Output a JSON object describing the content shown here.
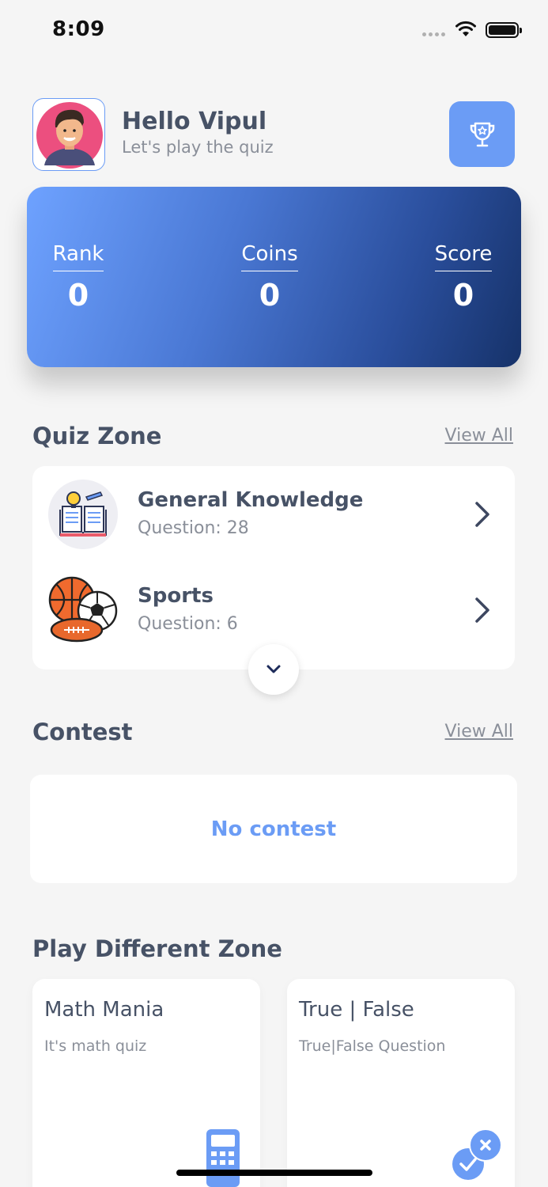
{
  "status_bar": {
    "time": "8:09"
  },
  "header": {
    "greeting": "Hello Vipul",
    "subtitle": "Let's play the quiz"
  },
  "stats": {
    "rank_label": "Rank",
    "rank_value": "0",
    "coins_label": "Coins",
    "coins_value": "0",
    "score_label": "Score",
    "score_value": "0"
  },
  "quiz_zone": {
    "title": "Quiz Zone",
    "view_all": "View All",
    "items": [
      {
        "name": "General Knowledge",
        "count": "Question: 28",
        "icon": "book-lightbulb-icon"
      },
      {
        "name": "Sports",
        "count": "Question: 6",
        "icon": "sports-balls-icon"
      }
    ]
  },
  "contest": {
    "title": "Contest",
    "view_all": "View All",
    "empty_text": "No contest"
  },
  "play_zone": {
    "title": "Play Different Zone",
    "cards": [
      {
        "title": "Math Mania",
        "subtitle": "It's math quiz",
        "icon": "calculator-icon"
      },
      {
        "title": "True | False",
        "subtitle": "True|False Question",
        "icon": "check-cross-icon"
      }
    ]
  },
  "colors": {
    "accent": "#6b9cf5",
    "gradient_start": "#6ea2ff",
    "gradient_end": "#163269",
    "heading": "#475266",
    "muted": "#8a8f99",
    "background": "#f5f5f5"
  }
}
